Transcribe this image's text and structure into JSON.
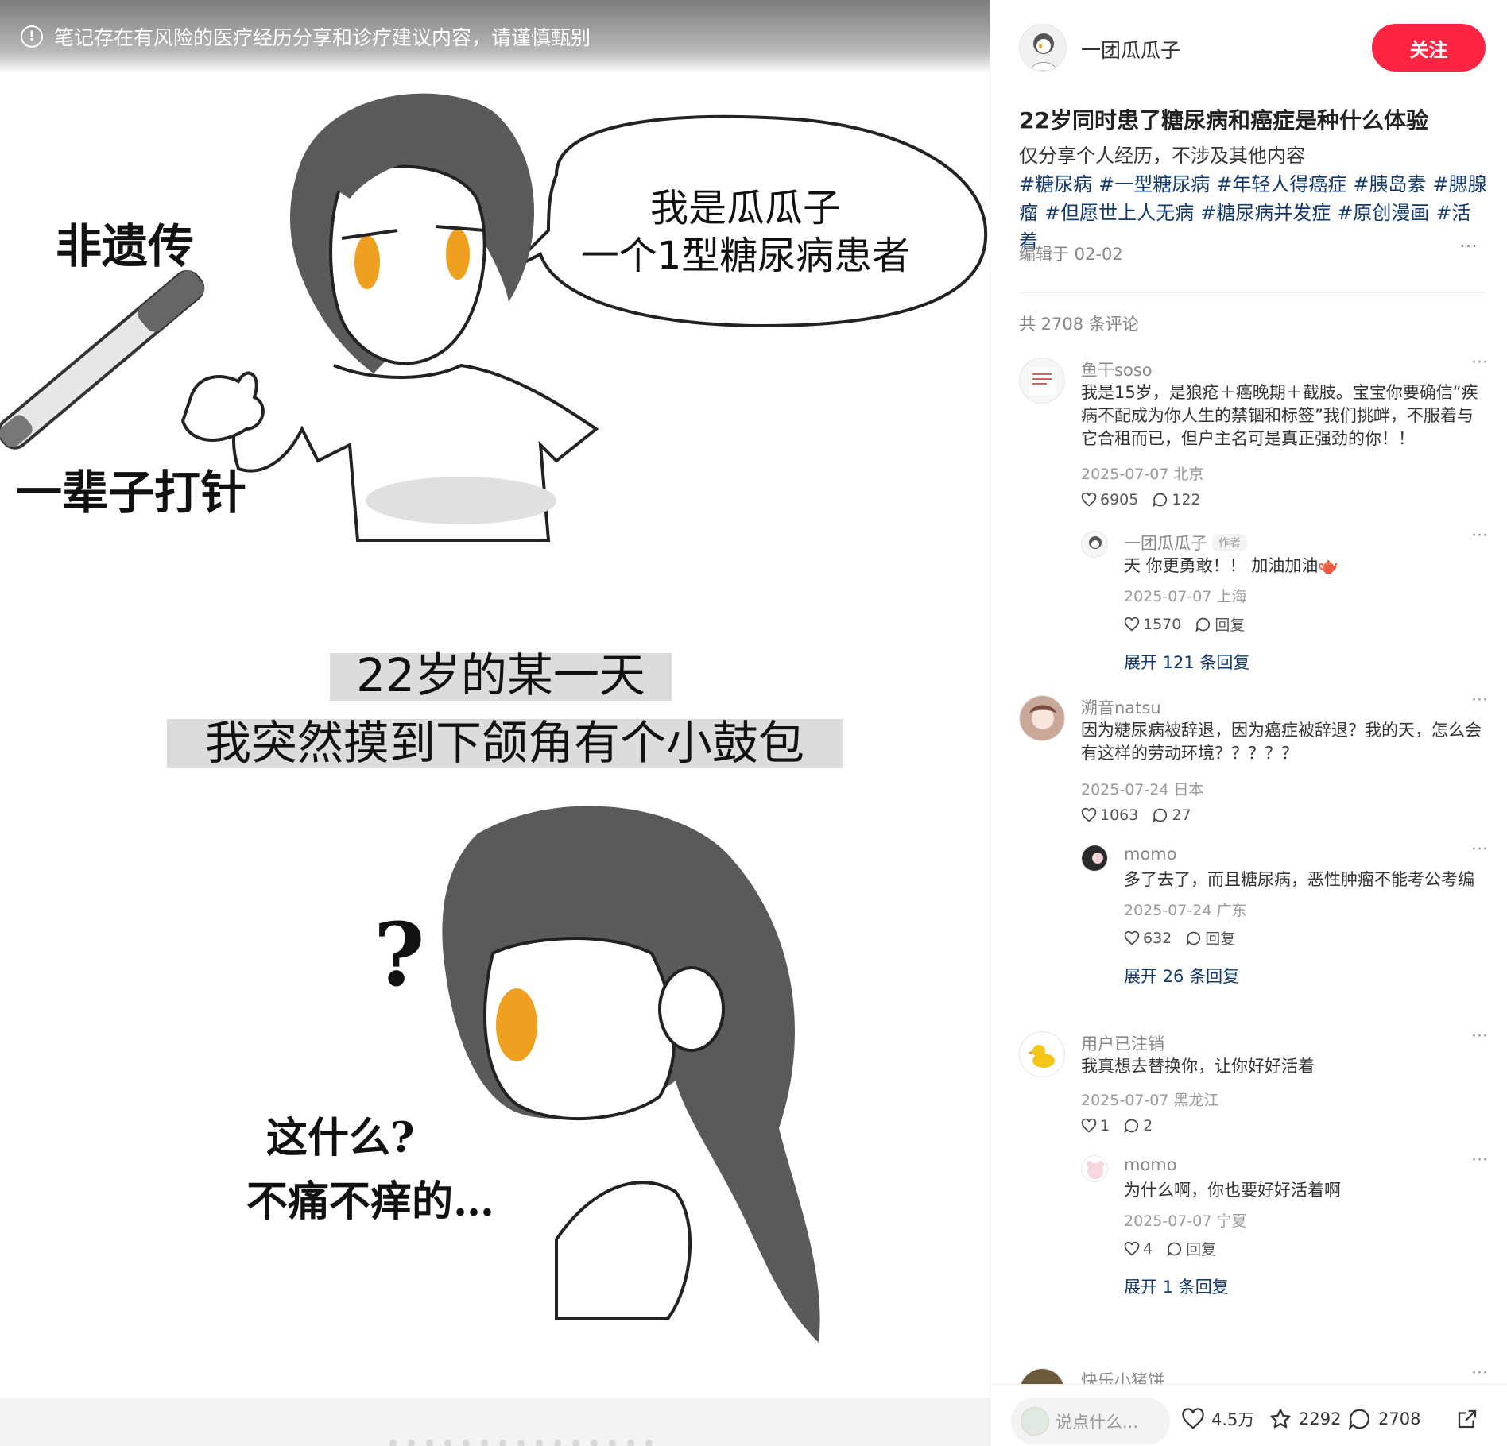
{
  "warning": {
    "text": "笔记存在有风险的医疗经历分享和诊疗建议内容，请谨慎甄别"
  },
  "art": {
    "bubble_line1": "我是瓜瓜子",
    "bubble_line2": "一个1型糖尿病患者",
    "side_text_1": "非遗传",
    "side_text_2": "一辈子打针",
    "caption_line1": "22岁的某一天",
    "caption_line2": "我突然摸到下颌角有个小鼓包",
    "question_mark": "?",
    "thought_line1": "这什么?",
    "thought_line2": "不痛不痒的…"
  },
  "author": {
    "name": "一团瓜瓜子",
    "follow_label": "关注"
  },
  "note": {
    "title": "22岁同时患了糖尿病和癌症是种什么体验",
    "desc": "仅分享个人经历，不涉及其他内容",
    "tags": [
      "#糖尿病",
      "#一型糖尿病",
      "#年轻人得癌症",
      "#胰岛素",
      "#腮腺瘤",
      "#但愿世上人无病",
      "#糖尿病并发症",
      "#原创漫画",
      "#活着"
    ],
    "date": "编辑于 02-02",
    "more": "···"
  },
  "comments_total": "共 2708 条评论",
  "comments": [
    {
      "name": "鱼干soso",
      "text": "我是15岁，是狼疮＋癌晚期＋截肢。宝宝你要确信“疾病不配成为你人生的禁锢和标签”我们挑衅，不服着与它合租而已，但户主名可是真正强劲的你！！",
      "meta": "2025-07-07 北京",
      "likes": "6905",
      "replies": "122",
      "reply": {
        "name": "一团瓜瓜子",
        "tag": "作者",
        "text": "天 你更勇敢！！ 加油加油🫖",
        "meta": "2025-07-07 上海",
        "likes": "1570",
        "reply_label": "回复"
      },
      "expand": "展开 121 条回复"
    },
    {
      "name": "溯音natsu",
      "text": "因为糖尿病被辞退，因为癌症被辞退？我的天，怎么会有这样的劳动环境？？？？？",
      "meta": "2025-07-24 日本",
      "likes": "1063",
      "replies": "27",
      "reply": {
        "name": "momo",
        "text": "多了去了，而且糖尿病，恶性肿瘤不能考公考编",
        "meta": "2025-07-24 广东",
        "likes": "632",
        "reply_label": "回复"
      },
      "expand": "展开 26 条回复"
    },
    {
      "name": "用户已注销",
      "text": "我真想去替换你，让你好好活着",
      "meta": "2025-07-07 黑龙江",
      "likes": "1",
      "replies": "2",
      "reply": {
        "name": "momo",
        "text": "为什么啊，你也要好好活着啊",
        "meta": "2025-07-07 宁夏",
        "likes": "4",
        "reply_label": "回复"
      },
      "expand": "展开 1 条回复"
    },
    {
      "name": "快乐小猪饼"
    }
  ],
  "engage": {
    "input_placeholder": "说点什么...",
    "likes": "4.5万",
    "collects": "2292",
    "comments": "2708"
  },
  "colors": {
    "accent": "#ff2442",
    "link": "#13386c",
    "eye": "#f0a020"
  }
}
